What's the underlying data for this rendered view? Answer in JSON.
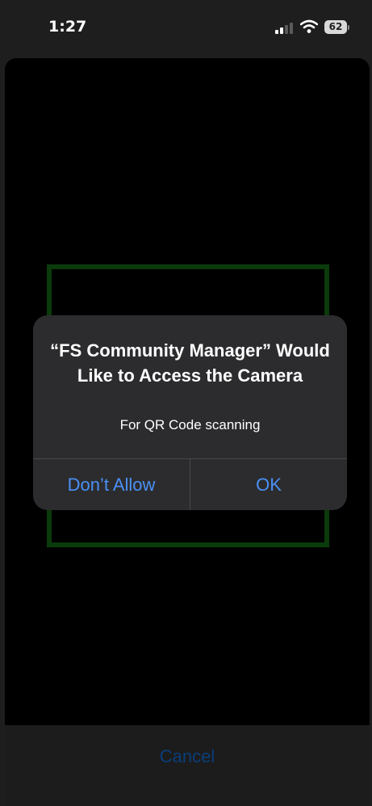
{
  "status_bar": {
    "time": "1:27",
    "battery": "62"
  },
  "alert": {
    "title": "“FS Community Manager” Would Like to Access the Camera",
    "message": "For QR Code scanning",
    "deny_label": "Don’t Allow",
    "ok_label": "OK"
  },
  "footer": {
    "cancel_label": "Cancel"
  },
  "colors": {
    "accent": "#4a90f5",
    "scan_frame": "#0b3a0b",
    "alert_bg": "#2c2c2e"
  }
}
